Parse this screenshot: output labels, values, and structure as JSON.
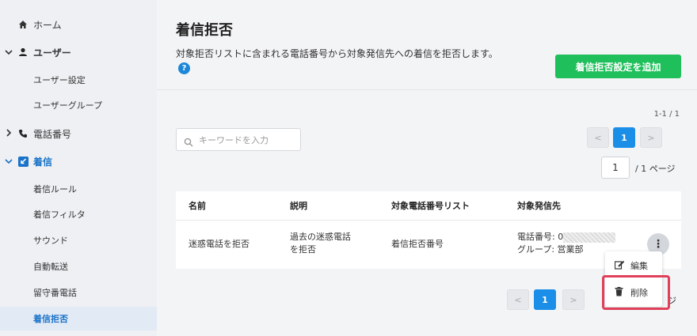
{
  "sidebar": {
    "home": "ホーム",
    "users": "ユーザー",
    "user_settings": "ユーザー設定",
    "user_groups": "ユーザーグループ",
    "phone_numbers": "電話番号",
    "incoming": "着信",
    "incoming_sub": [
      "着信ルール",
      "着信フィルタ",
      "サウンド",
      "自動転送",
      "留守番電話",
      "着信拒否"
    ]
  },
  "page": {
    "title": "着信拒否",
    "description": "対象拒否リストに含まれる電話番号から対象発信先への着信を拒否します。",
    "help": "?",
    "add_button": "着信拒否設定を追加"
  },
  "pagination": {
    "count": "1-1 / 1",
    "current": "1",
    "prev": "<",
    "next": ">",
    "page_input": "1",
    "total": "/ 1 ページ",
    "trail": "ジ"
  },
  "search": {
    "placeholder": "キーワードを入力"
  },
  "table": {
    "headers": [
      "名前",
      "説明",
      "対象電話番号リスト",
      "対象発信先"
    ],
    "row": {
      "name": "迷惑電話を拒否",
      "description_line1": "過去の迷惑電話",
      "description_line2": "を拒否",
      "list": "着信拒否番号",
      "target_phone": "電話番号: 0",
      "target_group": "グループ: 営業部"
    },
    "more": "⋮"
  },
  "menu": {
    "edit": "編集",
    "delete": "削除"
  },
  "colors": {
    "accent": "#1b8ee8",
    "add_button": "#1fbf5b",
    "highlight": "#e0405a",
    "active_nav": "#1a73c9"
  }
}
